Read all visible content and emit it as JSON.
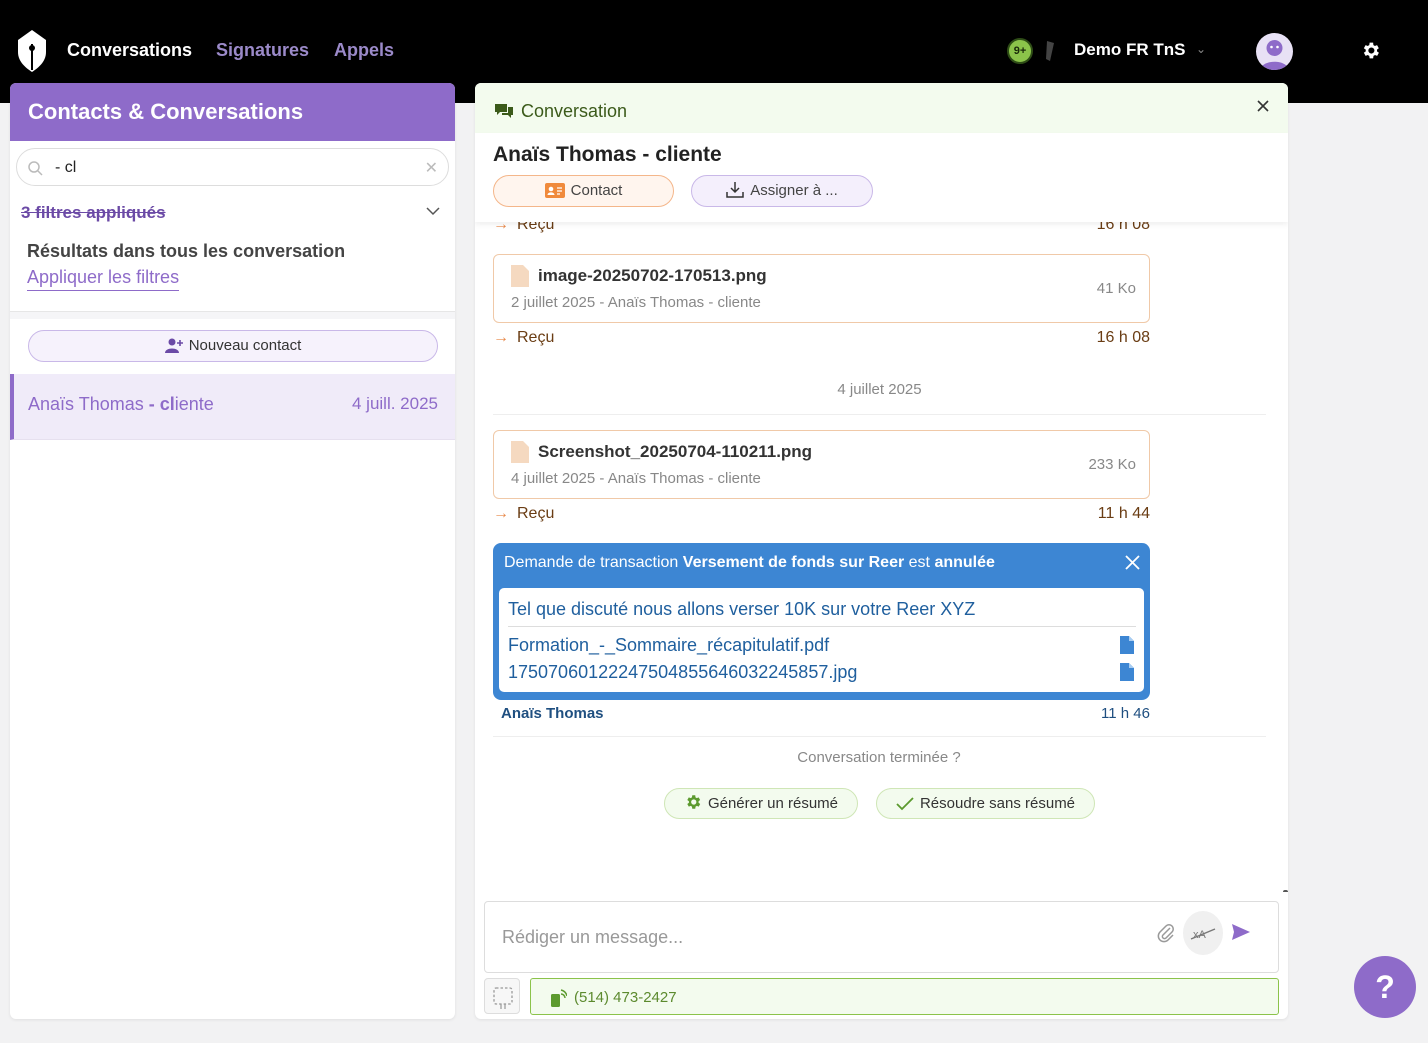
{
  "nav": {
    "items": [
      {
        "label": "Conversations",
        "active": true
      },
      {
        "label": "Signatures",
        "active": false
      },
      {
        "label": "Appels",
        "active": false
      }
    ],
    "notifications_badge": "9+",
    "account_name": "Demo FR TnS"
  },
  "sidebar": {
    "title": "Contacts & Conversations",
    "search_value": "- cl",
    "filters_label": "3 filtres appliqués",
    "results_title": "Résultats dans tous les conversation",
    "apply_filters_link": "Appliquer les filtres",
    "new_contact_label": "Nouveau contact",
    "contacts": [
      {
        "name_prefix": "Anaïs Thomas ",
        "name_match": "- cl",
        "name_suffix": "iente",
        "date": "4 juill. 2025"
      }
    ]
  },
  "conversation": {
    "header_title": "Conversation",
    "person_name": "Anaïs Thomas - cliente",
    "contact_button": "Contact",
    "assign_button": "Assigner à ...",
    "top_received": {
      "label": "Reçu",
      "time": "16 h 08"
    },
    "messages": [
      {
        "file_name": "image-20250702-170513.png",
        "meta": "2 juillet 2025 - Anaïs Thomas - cliente",
        "size": "41 Ko",
        "status": "Reçu",
        "time": "16 h 08"
      },
      {
        "file_name": "Screenshot_20250704-110211.png",
        "meta": "4 juillet 2025 - Anaïs Thomas - cliente",
        "size": "233 Ko",
        "status": "Reçu",
        "time": "11 h 44"
      }
    ],
    "date_separator": "4 juillet 2025",
    "transaction": {
      "title_prefix": "Demande de transaction ",
      "title_subject": "Versement de fonds sur Reer",
      "title_middle": " est ",
      "title_status": "annulée",
      "message": "Tel que discuté nous allons verser 10K sur votre Reer XYZ",
      "files": [
        "Formation_-_Sommaire_récapitulatif.pdf",
        "17507060122247504855646032245857.jpg"
      ],
      "author": "Anaïs Thomas",
      "time": "11 h 46"
    },
    "end_question": "Conversation terminée ?",
    "generate_summary_button": "Générer un résumé",
    "resolve_button": "Résoudre sans résumé",
    "composer_placeholder": "Rédiger un message...",
    "phone": "(514) 473-2427"
  },
  "help_label": "?",
  "colors": {
    "brand_purple": "#8e6bc9",
    "accent_blue": "#3d86d3",
    "accent_green": "#8bc34a",
    "accent_orange": "#f4b68a"
  }
}
